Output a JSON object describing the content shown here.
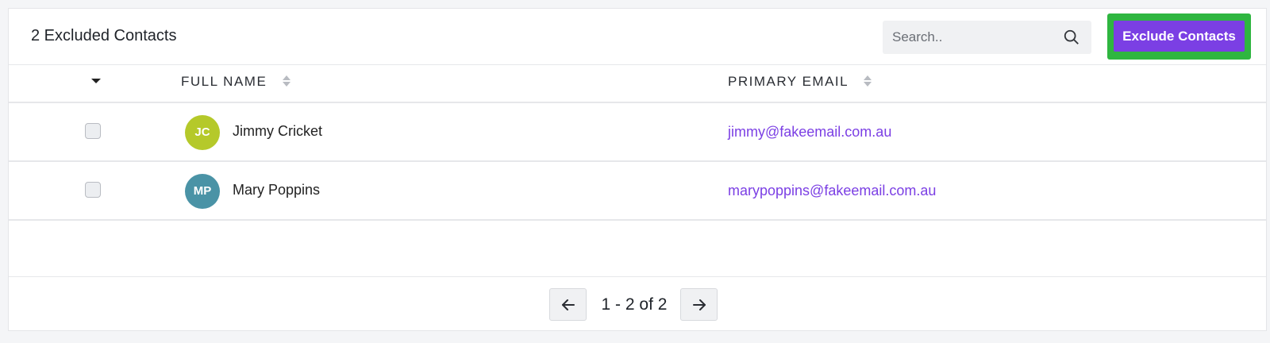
{
  "header": {
    "title": "2 Excluded Contacts",
    "search_placeholder": "Search..",
    "exclude_button_label": "Exclude Contacts"
  },
  "table": {
    "columns": [
      "FULL NAME",
      "PRIMARY EMAIL"
    ],
    "rows": [
      {
        "initials": "JC",
        "name": "Jimmy Cricket",
        "email": "jimmy@fakeemail.com.au",
        "avatar_color": "#b5c92a"
      },
      {
        "initials": "MP",
        "name": "Mary Poppins",
        "email": "marypoppins@fakeemail.com.au",
        "avatar_color": "#4a93a6"
      }
    ]
  },
  "pagination": {
    "label": "1 - 2 of 2"
  },
  "colors": {
    "accent": "#7b3fe4",
    "highlight_border": "#2fb640"
  },
  "icons": {
    "search": "search-icon",
    "sort": "sort-icon",
    "select_caret": "caret-down-icon",
    "prev": "arrow-left-icon",
    "next": "arrow-right-icon"
  }
}
